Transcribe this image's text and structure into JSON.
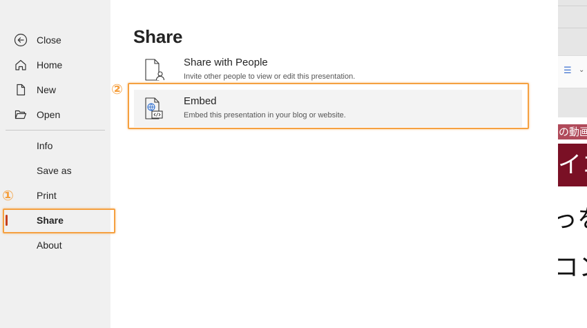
{
  "nav": {
    "items": [
      {
        "label": "Close",
        "icon": "back-arrow-icon"
      },
      {
        "label": "Home",
        "icon": "home-icon"
      },
      {
        "label": "New",
        "icon": "new-document-icon"
      },
      {
        "label": "Open",
        "icon": "folder-open-icon"
      },
      {
        "label": "Info"
      },
      {
        "label": "Save as"
      },
      {
        "label": "Print"
      },
      {
        "label": "Share",
        "active": true
      },
      {
        "label": "About"
      }
    ]
  },
  "main": {
    "title": "Share",
    "options": [
      {
        "title": "Share with People",
        "description": "Invite other people to view or edit this presentation.",
        "icon": "share-people-icon"
      },
      {
        "title": "Embed",
        "description": "Embed this presentation in your blog or website.",
        "icon": "embed-icon"
      }
    ]
  },
  "preview": {
    "band1_text": "の動画",
    "band2_text": "イコ",
    "text1": "っを",
    "text2": "コン"
  },
  "annotations": {
    "step1": "①",
    "step2": "②",
    "color": "#f5a040"
  },
  "colors": {
    "accent": "#c43e1c",
    "nav_bg": "#f0f0f0",
    "highlight_bg": "#f3f3f3"
  }
}
